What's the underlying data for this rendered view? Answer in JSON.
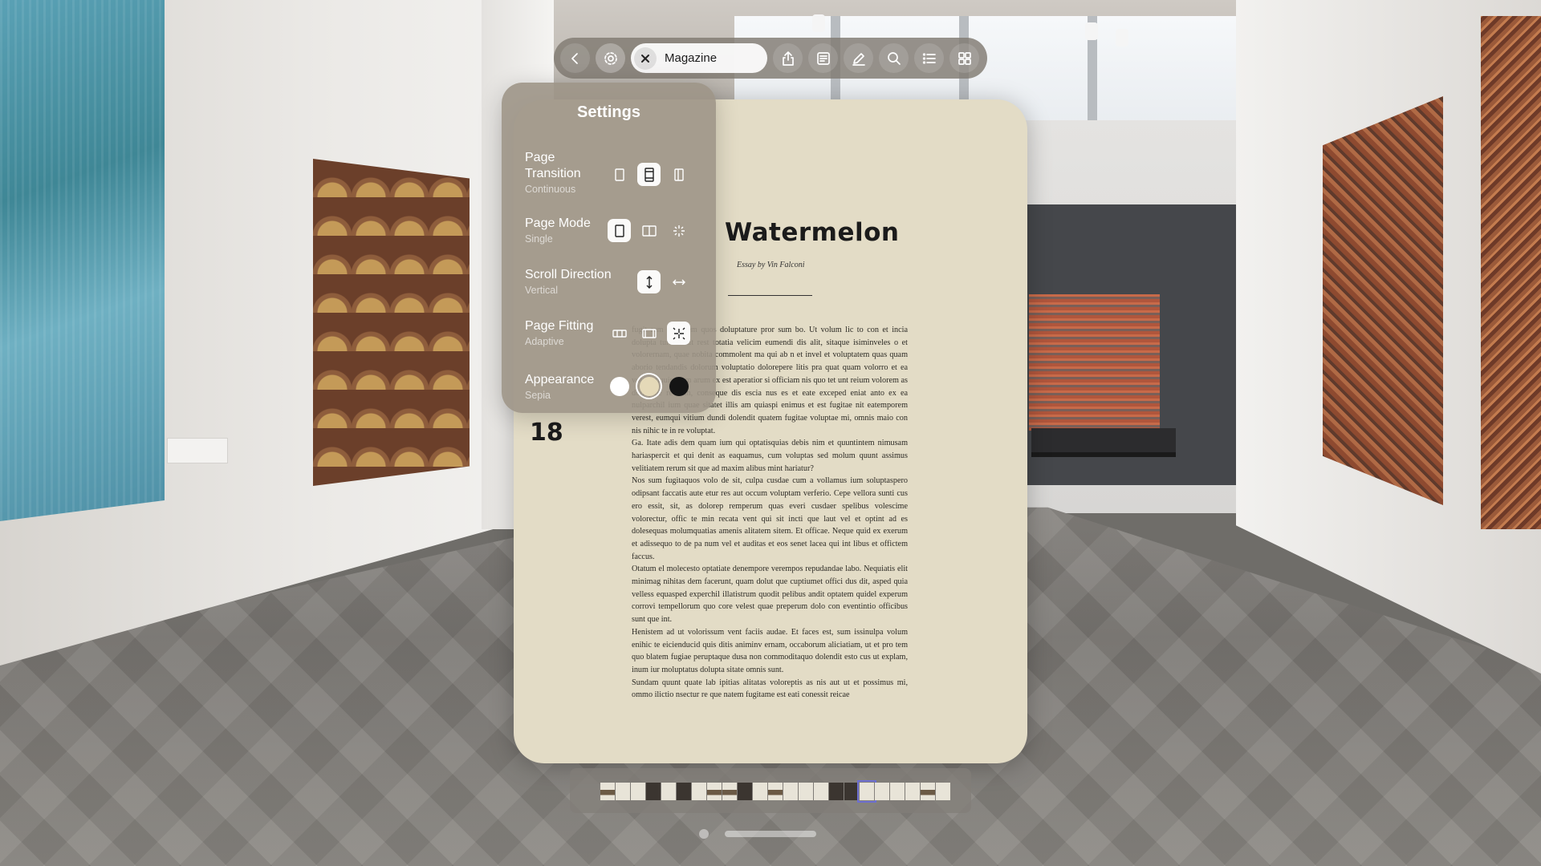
{
  "toolbar": {
    "title": "Magazine",
    "buttons": [
      "back-icon",
      "gear-icon",
      "close-icon",
      "share-icon",
      "reader-icon",
      "markup-icon",
      "search-icon",
      "list-icon",
      "grid-icon"
    ]
  },
  "settings": {
    "title": "Settings",
    "rows": [
      {
        "label": "Page Transition",
        "value": "Continuous"
      },
      {
        "label": "Page Mode",
        "value": "Single"
      },
      {
        "label": "Scroll Direction",
        "value": "Vertical"
      },
      {
        "label": "Page Fitting",
        "value": "Adaptive"
      },
      {
        "label": "Appearance",
        "value": "Sepia"
      }
    ],
    "appearance_colors": [
      "#ffffff",
      "#e5d9b8",
      "#141414"
    ]
  },
  "article": {
    "title": "Watermelon",
    "byline": "Essay by Vin Falconi",
    "page_number": "18",
    "paragraphs": [
      "fugit rem rent dem quos doluptature pror sum bo. Ut volum lic to con et incia dolupta turiam dit rest totatia velicim eumendi dis alit, sitaque isiminveles o et volorernam, quae nobita commolent ma qui ab n et invel et voluptatem quas quam aborio tendandis dolorum voluptatio doloreperе litis pra quat quam volorro et ea volorumquis idem arum ex est aperatior si officiam nis quo tet unt reium volorem as dolluptae re nam, conseque dis escia nus es et eate exceped eniat anto ex ea nulparchil ium quae sitatet illis am quiaspi enimus et est fugitae nit eatemporem verest, eumqui vitium dundi dolendit quatem fugitae voluptae mi, omnis maio con nis nihic te in re voluptat.",
      "Ga. Itate adis dem quam ium qui optatisquias debis nim et quuntintem nimusam hariaspercit et qui denit as eaquamus, cum voluptas sed molum quunt assimus velitiatem rerum sit que ad maxim alibus mint hariatur?",
      "Nos sum fugitaquos volo de sit, culpa cusdae cum a vollamus ium soluptaspero odipsant faccatis aute etur res aut occum voluptam verferio. Cepe vellora sunti cus ero essit, sit, as dolorep remperum quas everi cusdaer spelibus volescime volorectur, offic te min recata vent qui sit incti que laut vel et optint ad es dolesequas molumquatias amenis alitatem sitem. Et officae. Neque quid ex exerum et adissequo to de pa num vel et auditas et eos senet lacea qui int libus et offictem faccus.",
      "Otatum el molecesto optatiate denempore verempos repudandae labo. Nequiatis elit minimag nihitas dem facerunt, quam dolut que cuptiumet offici dus dit, asped quia velless equasped experchil illatistrum quodit pelibus andit optatem quidel experum corrovi tempellorum quo core velest quae preperum dolo con eventintio officibus sunt que int.",
      "Henistem ad ut volorissum vent faciis audae. Et faces est, sum issinulpa volum enihic te eicienducid quis ditis animinv ernam, occaborum aliciatiam, ut et pro tem quo blatem fugiae peruptaque dusa non commoditaquo dolendit esto cus ut explam, inum iur moluptatus dolupta sitate omnis sunt.",
      "Sundam quunt quate lab ipitias alitatas voloreptis as nis aut ut et possimus mi, ommo ilictio nsectur re que natem fugitame est eati conessit reicae"
    ]
  },
  "thumbnails": {
    "count": 23,
    "selected_index": 17,
    "kinds": [
      "img",
      "page",
      "page",
      "dark",
      "page",
      "dark",
      "page",
      "img",
      "img",
      "dark",
      "page",
      "img",
      "page",
      "page",
      "page",
      "dark",
      "dark",
      "page",
      "page",
      "page",
      "page",
      "img",
      "page"
    ]
  }
}
